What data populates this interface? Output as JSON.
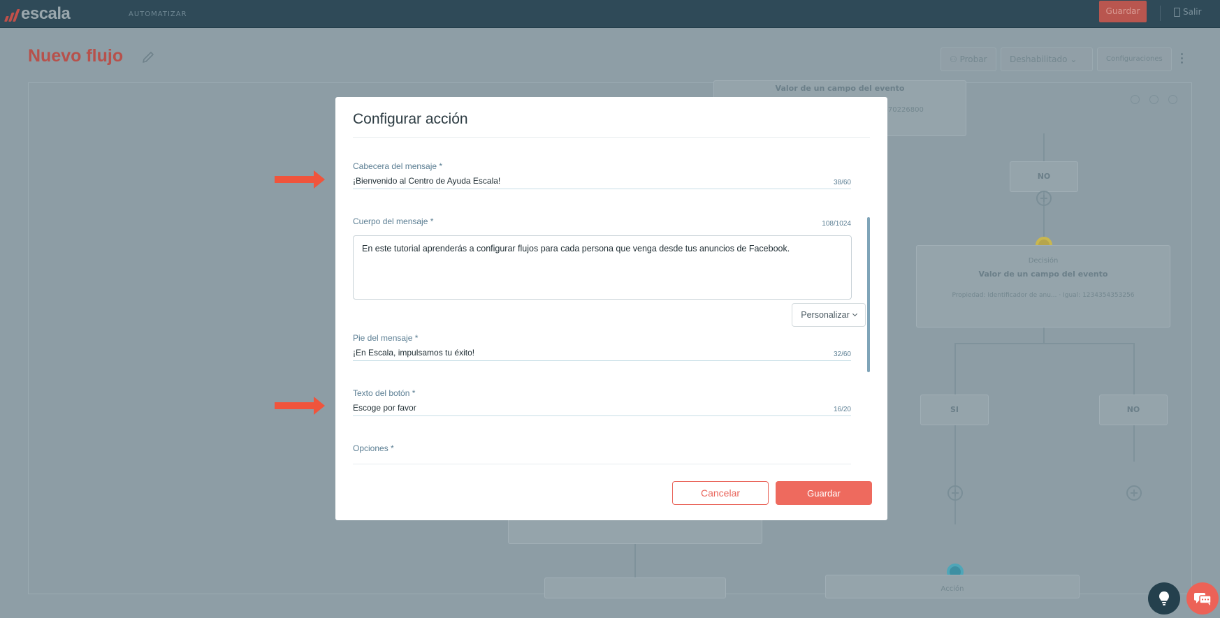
{
  "app": {
    "logo_text": "escala",
    "section": "AUTOMATIZAR",
    "save_label": "Guardar",
    "exit_label": "Salir"
  },
  "page": {
    "title": "Nuevo flujo",
    "actions": {
      "test": "Probar",
      "status": "Deshabilitado",
      "settings": "Configuraciones"
    }
  },
  "canvas": {
    "nodes": {
      "top_title": "Valor de un campo del evento",
      "top_sub": "0670226800",
      "no_1": "NO",
      "decision_label": "Decisión",
      "decision_title": "Valor de un campo del evento",
      "decision_sub": "Propiedad: Identificador de anu... · Igual: 1234354353256",
      "si": "SI",
      "no_2": "NO",
      "action_label": "Acción"
    }
  },
  "modal": {
    "title": "Configurar acción",
    "fields": {
      "header": {
        "label": "Cabecera del mensaje",
        "required": "*",
        "value": "¡Bienvenido al Centro de Ayuda Escala!",
        "count": "38/60"
      },
      "body": {
        "label": "Cuerpo del mensaje",
        "required": "*",
        "value": "En este tutorial aprenderás a configurar flujos para cada persona que venga desde tus anuncios de Facebook.",
        "count": "108/1024",
        "personalize": "Personalizar"
      },
      "footer": {
        "label": "Pie del mensaje",
        "required": "*",
        "value": "¡En Escala, impulsamos tu éxito!",
        "count": "32/60"
      },
      "button_text": {
        "label": "Texto del botón",
        "required": "*",
        "value": "Escoge por favor",
        "count": "16/20"
      },
      "options": {
        "label": "Opciones",
        "required": "*"
      }
    },
    "cancel_label": "Cancelar",
    "save_label": "Guardar"
  },
  "colors": {
    "accent": "#ee6a5e",
    "arrow": "#f0543c",
    "label": "#5b7e93",
    "topbar": "#2f4a58"
  },
  "icons": [
    "pencil-icon",
    "door-icon",
    "lightbulb-icon",
    "chat-icon",
    "arrow-right-icon",
    "chevron-down-icon"
  ]
}
